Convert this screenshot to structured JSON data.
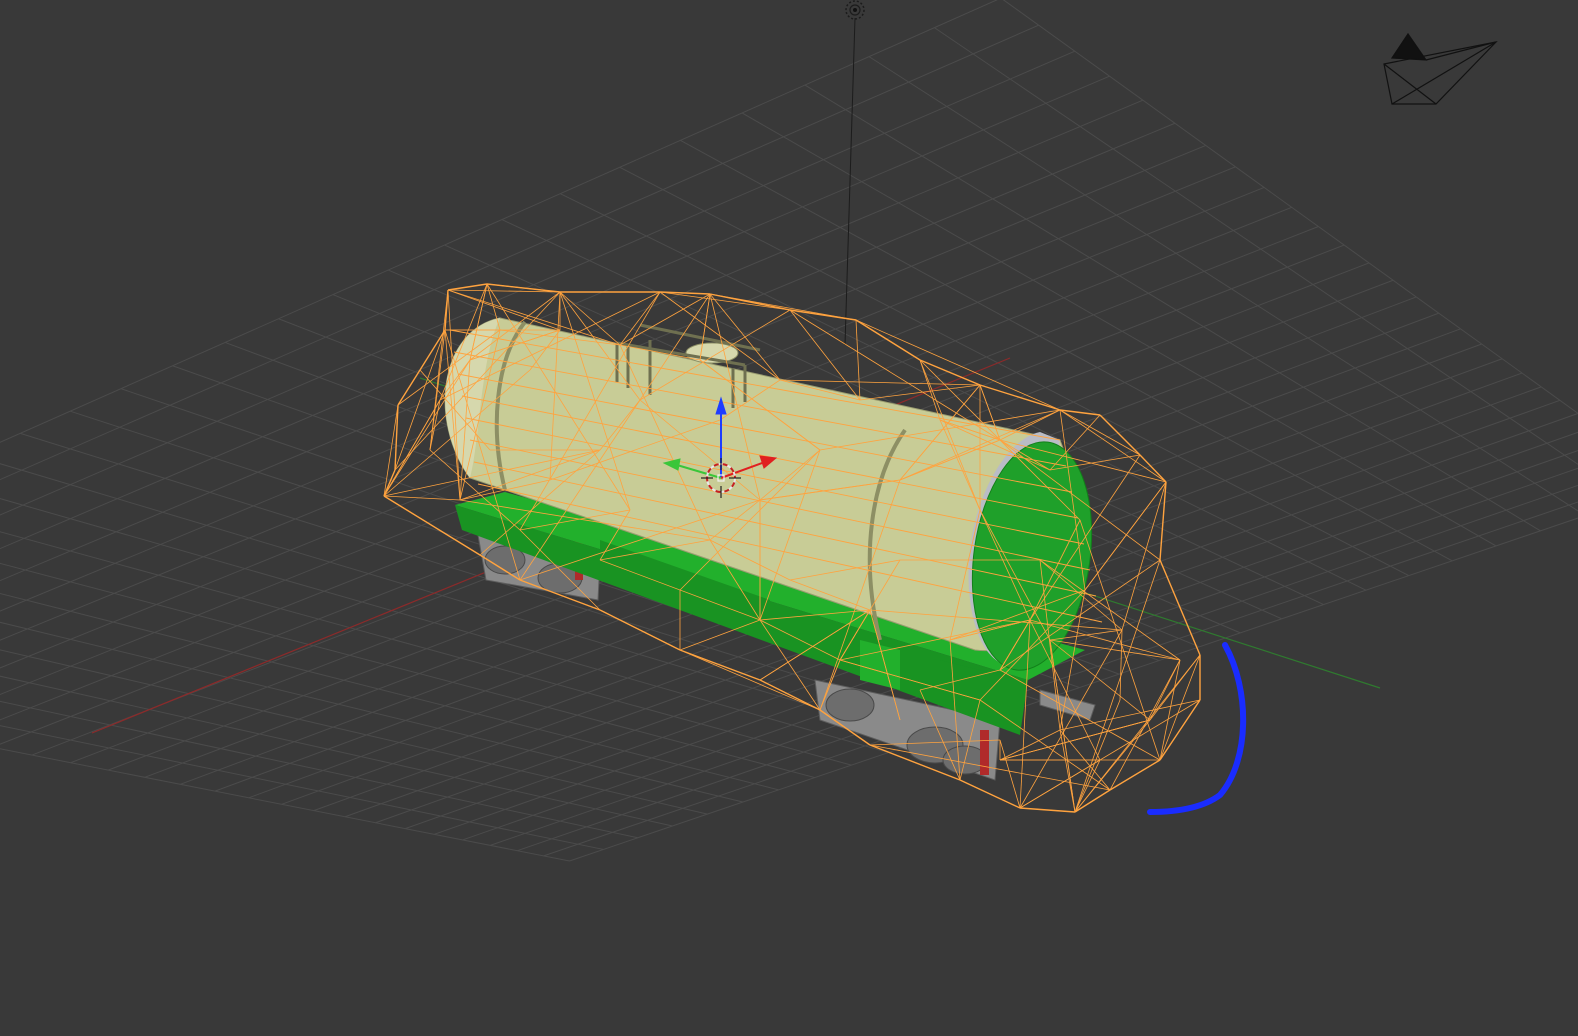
{
  "viewport": {
    "background_color": "#393939",
    "grid_color": "#4b4b4b",
    "x_axis_color": "#8c2a2a",
    "y_axis_color": "#2f7a2f",
    "selection_wire_color": "#ffa33f",
    "tank_body_color": "#c8cc96",
    "tank_end_color": "#1fa02a",
    "frame_color": "#22b02c",
    "bogie_color": "#8a8a8a",
    "gizmo": {
      "z_color": "#1e3cff",
      "y_color": "#3ac63a",
      "x_color": "#e02020"
    },
    "rotation_hint_color": "#1a2cff"
  },
  "scene": {
    "objects": [
      "light-lamp",
      "camera",
      "tank-car",
      "3d-cursor",
      "transform-gizmo"
    ]
  }
}
